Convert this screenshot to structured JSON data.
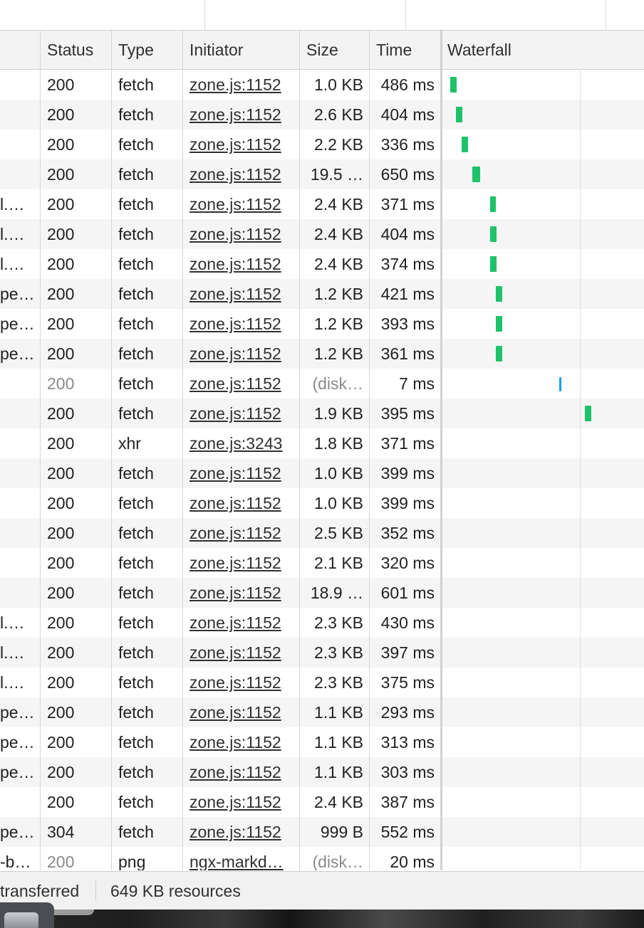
{
  "columns": {
    "status": "Status",
    "type": "Type",
    "initiator": "Initiator",
    "size": "Size",
    "time": "Time",
    "waterfall": "Waterfall"
  },
  "rows": [
    {
      "name": "",
      "status": "200",
      "type": "fetch",
      "initiator": "zone.js:1152",
      "size": "1.0 KB",
      "time": "486 ms",
      "from_cache": false,
      "bar_start": 0.055,
      "bar_width": 0.045
    },
    {
      "name": "",
      "status": "200",
      "type": "fetch",
      "initiator": "zone.js:1152",
      "size": "2.6 KB",
      "time": "404 ms",
      "from_cache": false,
      "bar_start": 0.097,
      "bar_width": 0.045
    },
    {
      "name": "",
      "status": "200",
      "type": "fetch",
      "initiator": "zone.js:1152",
      "size": "2.2 KB",
      "time": "336 ms",
      "from_cache": false,
      "bar_start": 0.137,
      "bar_width": 0.045
    },
    {
      "name": "",
      "status": "200",
      "type": "fetch",
      "initiator": "zone.js:1152",
      "size": "19.5 …",
      "time": "650 ms",
      "from_cache": false,
      "bar_start": 0.21,
      "bar_width": 0.06
    },
    {
      "name": "l.…",
      "status": "200",
      "type": "fetch",
      "initiator": "zone.js:1152",
      "size": "2.4 KB",
      "time": "371 ms",
      "from_cache": false,
      "bar_start": 0.34,
      "bar_width": 0.04
    },
    {
      "name": "l.…",
      "status": "200",
      "type": "fetch",
      "initiator": "zone.js:1152",
      "size": "2.4 KB",
      "time": "404 ms",
      "from_cache": false,
      "bar_start": 0.34,
      "bar_width": 0.045
    },
    {
      "name": "l.…",
      "status": "200",
      "type": "fetch",
      "initiator": "zone.js:1152",
      "size": "2.4 KB",
      "time": "374 ms",
      "from_cache": false,
      "bar_start": 0.34,
      "bar_width": 0.045
    },
    {
      "name": "pe…",
      "status": "200",
      "type": "fetch",
      "initiator": "zone.js:1152",
      "size": "1.2 KB",
      "time": "421 ms",
      "from_cache": false,
      "bar_start": 0.38,
      "bar_width": 0.045
    },
    {
      "name": "pe…",
      "status": "200",
      "type": "fetch",
      "initiator": "zone.js:1152",
      "size": "1.2 KB",
      "time": "393 ms",
      "from_cache": false,
      "bar_start": 0.38,
      "bar_width": 0.045
    },
    {
      "name": "pe…",
      "status": "200",
      "type": "fetch",
      "initiator": "zone.js:1152",
      "size": "1.2 KB",
      "time": "361 ms",
      "from_cache": false,
      "bar_start": 0.38,
      "bar_width": 0.045
    },
    {
      "name": "",
      "status": "200",
      "type": "fetch",
      "initiator": "zone.js:1152",
      "size": "(disk…",
      "time": "7 ms",
      "from_cache": true,
      "bar_start": 0.83,
      "bar_width": 0.015
    },
    {
      "name": "",
      "status": "200",
      "type": "fetch",
      "initiator": "zone.js:1152",
      "size": "1.9 KB",
      "time": "395 ms",
      "from_cache": false,
      "bar_start": 1.01,
      "bar_width": 0.045
    },
    {
      "name": "",
      "status": "200",
      "type": "xhr",
      "initiator": "zone.js:3243",
      "size": "1.8 KB",
      "time": "371 ms",
      "from_cache": false,
      "bar_start": null,
      "bar_width": null
    },
    {
      "name": "",
      "status": "200",
      "type": "fetch",
      "initiator": "zone.js:1152",
      "size": "1.0 KB",
      "time": "399 ms",
      "from_cache": false,
      "bar_start": null,
      "bar_width": null
    },
    {
      "name": "",
      "status": "200",
      "type": "fetch",
      "initiator": "zone.js:1152",
      "size": "1.0 KB",
      "time": "399 ms",
      "from_cache": false,
      "bar_start": null,
      "bar_width": null
    },
    {
      "name": "",
      "status": "200",
      "type": "fetch",
      "initiator": "zone.js:1152",
      "size": "2.5 KB",
      "time": "352 ms",
      "from_cache": false,
      "bar_start": null,
      "bar_width": null
    },
    {
      "name": "",
      "status": "200",
      "type": "fetch",
      "initiator": "zone.js:1152",
      "size": "2.1 KB",
      "time": "320 ms",
      "from_cache": false,
      "bar_start": null,
      "bar_width": null
    },
    {
      "name": "",
      "status": "200",
      "type": "fetch",
      "initiator": "zone.js:1152",
      "size": "18.9 …",
      "time": "601 ms",
      "from_cache": false,
      "bar_start": null,
      "bar_width": null
    },
    {
      "name": "l.…",
      "status": "200",
      "type": "fetch",
      "initiator": "zone.js:1152",
      "size": "2.3 KB",
      "time": "430 ms",
      "from_cache": false,
      "bar_start": null,
      "bar_width": null
    },
    {
      "name": "l.…",
      "status": "200",
      "type": "fetch",
      "initiator": "zone.js:1152",
      "size": "2.3 KB",
      "time": "397 ms",
      "from_cache": false,
      "bar_start": null,
      "bar_width": null
    },
    {
      "name": "l.…",
      "status": "200",
      "type": "fetch",
      "initiator": "zone.js:1152",
      "size": "2.3 KB",
      "time": "375 ms",
      "from_cache": false,
      "bar_start": null,
      "bar_width": null
    },
    {
      "name": "pe…",
      "status": "200",
      "type": "fetch",
      "initiator": "zone.js:1152",
      "size": "1.1 KB",
      "time": "293 ms",
      "from_cache": false,
      "bar_start": null,
      "bar_width": null
    },
    {
      "name": "pe…",
      "status": "200",
      "type": "fetch",
      "initiator": "zone.js:1152",
      "size": "1.1 KB",
      "time": "313 ms",
      "from_cache": false,
      "bar_start": null,
      "bar_width": null
    },
    {
      "name": "pe…",
      "status": "200",
      "type": "fetch",
      "initiator": "zone.js:1152",
      "size": "1.1 KB",
      "time": "303 ms",
      "from_cache": false,
      "bar_start": null,
      "bar_width": null
    },
    {
      "name": "",
      "status": "200",
      "type": "fetch",
      "initiator": "zone.js:1152",
      "size": "2.4 KB",
      "time": "387 ms",
      "from_cache": false,
      "bar_start": null,
      "bar_width": null
    },
    {
      "name": "pe…",
      "status": "304",
      "type": "fetch",
      "initiator": "zone.js:1152",
      "size": "999 B",
      "time": "552 ms",
      "from_cache": false,
      "bar_start": null,
      "bar_width": null
    },
    {
      "name": "-b…",
      "status": "200",
      "type": "png",
      "initiator": "ngx-markd…",
      "size": "(disk…",
      "time": "20 ms",
      "from_cache": true,
      "bar_start": null,
      "bar_width": null
    }
  ],
  "footer": {
    "transferred": "transferred",
    "resources": "649 KB resources"
  },
  "colors": {
    "network_bar": "#1ec26a",
    "cache_bar": "#1aa0e6"
  }
}
